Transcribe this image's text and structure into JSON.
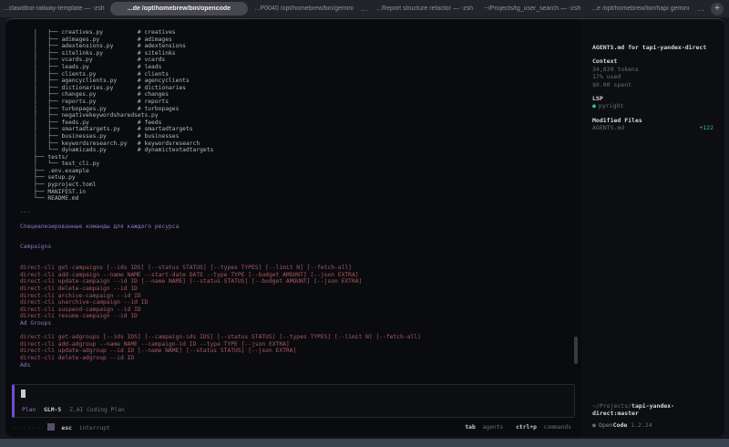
{
  "tabbar": {
    "tabs": [
      {
        "label": "...clawdbot-railway-template — -zsh",
        "active": false,
        "overflow": false
      },
      {
        "label": "...de /opt/homebrew/bin/opencode",
        "active": true,
        "overflow": false
      },
      {
        "label": "...P0040 /opt/homebrew/bin/gemini",
        "active": false,
        "overflow": true
      },
      {
        "label": "...Report structure refactor — -zsh",
        "active": false,
        "overflow": false
      },
      {
        "label": "~/Projects/tg_user_search — -zsh",
        "active": false,
        "overflow": false
      },
      {
        "label": "...e /opt/homebrew/bin/hapi gemini",
        "active": false,
        "overflow": true
      }
    ],
    "overflow_label": "…",
    "new_tab_label": "+"
  },
  "terminal": {
    "lines": [
      {
        "t": "    │   ├── creatives.py          # creatives",
        "c": "fg"
      },
      {
        "t": "    │   ├── adimages.py           # adimages",
        "c": "fg"
      },
      {
        "t": "    │   ├── adextensions.py       # adextensions",
        "c": "fg"
      },
      {
        "t": "    │   ├── sitelinks.py          # sitelinks",
        "c": "fg"
      },
      {
        "t": "    │   ├── vcards.py             # vcards",
        "c": "fg"
      },
      {
        "t": "    │   ├── leads.py              # leads",
        "c": "fg"
      },
      {
        "t": "    │   ├── clients.py            # clients",
        "c": "fg"
      },
      {
        "t": "    │   ├── agencyclients.py      # agencyclients",
        "c": "fg"
      },
      {
        "t": "    │   ├── dictionaries.py       # dictionaries",
        "c": "fg"
      },
      {
        "t": "    │   ├── changes.py            # changes",
        "c": "fg"
      },
      {
        "t": "    │   ├── reports.py            # reports",
        "c": "fg"
      },
      {
        "t": "    │   ├── turbopages.py         # turbopages",
        "c": "fg"
      },
      {
        "t": "    │   ├── negativekeywordsharedsets.py",
        "c": "fg"
      },
      {
        "t": "    │   ├── feeds.py              # feeds",
        "c": "fg"
      },
      {
        "t": "    │   ├── smartadtargets.py     # smartadtargets",
        "c": "fg"
      },
      {
        "t": "    │   ├── businesses.py         # businesses",
        "c": "fg"
      },
      {
        "t": "    │   ├── keywordsresearch.py   # keywordsresearch",
        "c": "fg"
      },
      {
        "t": "    │   └── dynamicads.py         # dynamictextadtargets",
        "c": "fg"
      },
      {
        "t": "    ├── tests/",
        "c": "fg"
      },
      {
        "t": "    │   └── test_cli.py",
        "c": "fg"
      },
      {
        "t": "    ├── .env.example",
        "c": "fg"
      },
      {
        "t": "    ├── setup.py",
        "c": "fg"
      },
      {
        "t": "    ├── pyproject.toml",
        "c": "fg"
      },
      {
        "t": "    ├── MANIFEST.in",
        "c": "fg"
      },
      {
        "t": "    └── README.md",
        "c": "fg"
      },
      {
        "t": "",
        "c": "fg"
      },
      {
        "t": "---",
        "c": "dim"
      },
      {
        "t": "",
        "c": "fg"
      },
      {
        "t": "Специализированные команды для каждого ресурса",
        "c": "h"
      },
      {
        "t": "",
        "c": "fg"
      },
      {
        "t": "",
        "c": "fg"
      },
      {
        "t": "Campaigns",
        "c": "h"
      },
      {
        "t": "",
        "c": "fg"
      },
      {
        "t": "",
        "c": "fg"
      },
      {
        "t": "direct-cli get-campaigns [--ids IDS] [--status STATUS] [--types TYPES] [--limit N] [--fetch-all]",
        "c": "cmd"
      },
      {
        "t": "direct-cli add-campaign --name NAME --start-date DATE --type TYPE [--budget AMOUNT] [--json EXTRA]",
        "c": "cmd"
      },
      {
        "t": "direct-cli update-campaign --id ID [--name NAME] [--status STATUS] [--budget AMOUNT] [--json EXTRA]",
        "c": "cmd"
      },
      {
        "t": "direct-cli delete-campaign --id ID",
        "c": "cmd"
      },
      {
        "t": "direct-cli archive-campaign --id ID",
        "c": "cmd"
      },
      {
        "t": "direct-cli unarchive-campaign --id ID",
        "c": "cmd"
      },
      {
        "t": "direct-cli suspend-campaign --id ID",
        "c": "cmd"
      },
      {
        "t": "direct-cli resume-campaign --id ID",
        "c": "cmd"
      },
      {
        "t": "Ad Groups",
        "c": "h"
      },
      {
        "t": "",
        "c": "fg"
      },
      {
        "t": "direct-cli get-adgroups [--ids IDS] [--campaign-ids IDS] [--status STATUS] [--types TYPES] [--limit N] [--fetch-all]",
        "c": "cmd"
      },
      {
        "t": "direct-cli add-adgroup --name NAME --campaign-id ID --type TYPE [--json EXTRA]",
        "c": "cmd"
      },
      {
        "t": "direct-cli update-adgroup --id ID [--name NAME] [--status STATUS] [--json EXTRA]",
        "c": "cmd"
      },
      {
        "t": "direct-cli delete-adgroup --id ID",
        "c": "cmd"
      },
      {
        "t": "Ads",
        "c": "h"
      }
    ]
  },
  "input": {
    "mode_label": "Plan",
    "model_label": "GLM-5",
    "plan_label": "Z.AI Coding Plan"
  },
  "statusbar": {
    "spinner_dots": "······",
    "esc_key": "esc",
    "esc_label": "interrupt",
    "tab_key": "tab",
    "tab_label": "agents",
    "cmd_key": "ctrl+p",
    "cmd_label": "commands"
  },
  "sidebar": {
    "title": "AGENTS.md for tapi-yandex-direct",
    "context": {
      "heading": "Context",
      "tokens": "34,839 tokens",
      "used": "17% used",
      "spent": "$0.00 spent"
    },
    "lsp": {
      "heading": "LSP",
      "dot": "●",
      "server": "pyright"
    },
    "modified": {
      "heading": "Modified Files",
      "file": "AGENTS.md",
      "diff": "+122"
    },
    "footer": {
      "path_prefix": "~/Projects/",
      "repo": "tapi-yandex-direct:master",
      "dot": "●",
      "app_name_1": "Open",
      "app_name_2": "Code",
      "version": "1.2.24"
    }
  },
  "colors": {
    "accent_purple": "#6b50d8",
    "heading_purple": "#8d76c4",
    "command_red": "#a85a60",
    "diff_green": "#3cbf86",
    "terminal_fg": "#b4b7bc",
    "muted": "#696e74"
  }
}
